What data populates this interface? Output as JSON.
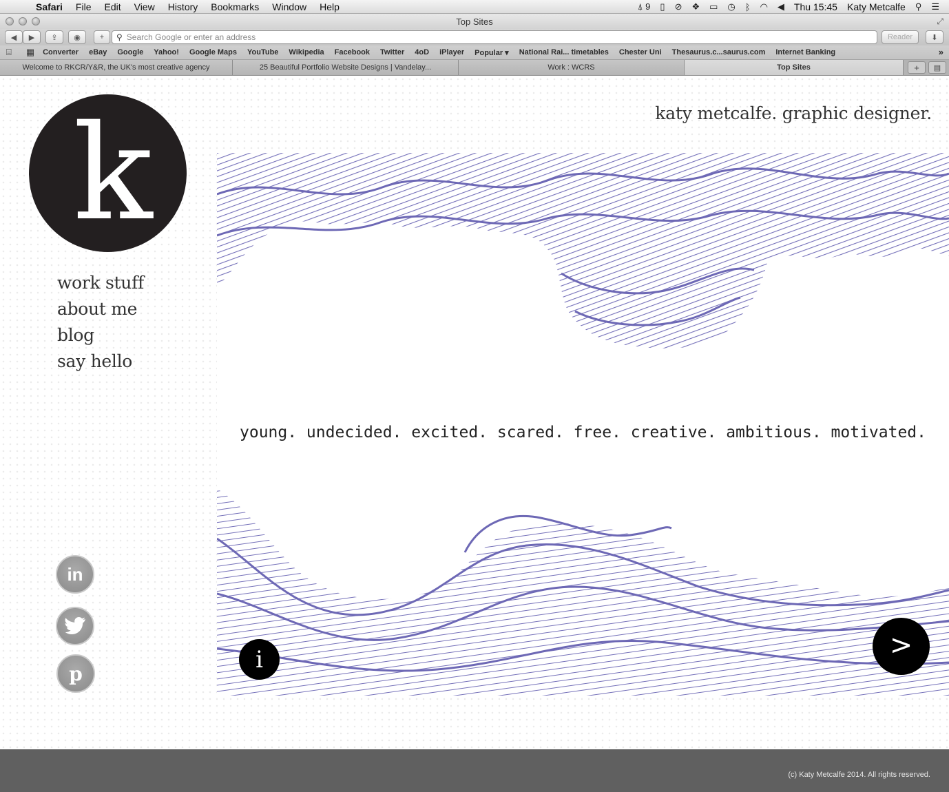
{
  "menubar": {
    "app": "Safari",
    "items": [
      "File",
      "Edit",
      "View",
      "History",
      "Bookmarks",
      "Window",
      "Help"
    ],
    "status_badge": "9",
    "clock": "Thu 15:45",
    "user": "Katy Metcalfe"
  },
  "window": {
    "title": "Top Sites"
  },
  "toolbar": {
    "address_placeholder": "Search Google or enter an address",
    "reader_label": "Reader"
  },
  "bookmarks": [
    "Converter",
    "eBay",
    "Google",
    "Yahoo!",
    "Google Maps",
    "YouTube",
    "Wikipedia",
    "Facebook",
    "Twitter",
    "4oD",
    "iPlayer",
    "Popular ▾",
    "National Rai... timetables",
    "Chester Uni",
    "Thesaurus.c...saurus.com",
    "Internet Banking"
  ],
  "tabs": [
    {
      "label": "Welcome to RKCR/Y&R, the UK's most creative agency"
    },
    {
      "label": "25 Beautiful Portfolio Website Designs | Vandelay..."
    },
    {
      "label": "Work : WCRS"
    },
    {
      "label": "Top Sites"
    }
  ],
  "site": {
    "logo_letter": "k",
    "heading": "katy metcalfe. graphic designer.",
    "nav": [
      "work stuff",
      "about me",
      "blog",
      "say hello"
    ],
    "motto": "young. undecided. excited. scared. free. creative. ambitious. motivated.",
    "info_symbol": "i",
    "next_symbol": ">",
    "social": {
      "linkedin": "in",
      "twitter": "t",
      "pinterest": "p"
    },
    "footer": "(c) Katy Metcalfe 2014. All rights reserved.",
    "accent_color": "#6d68b5"
  }
}
